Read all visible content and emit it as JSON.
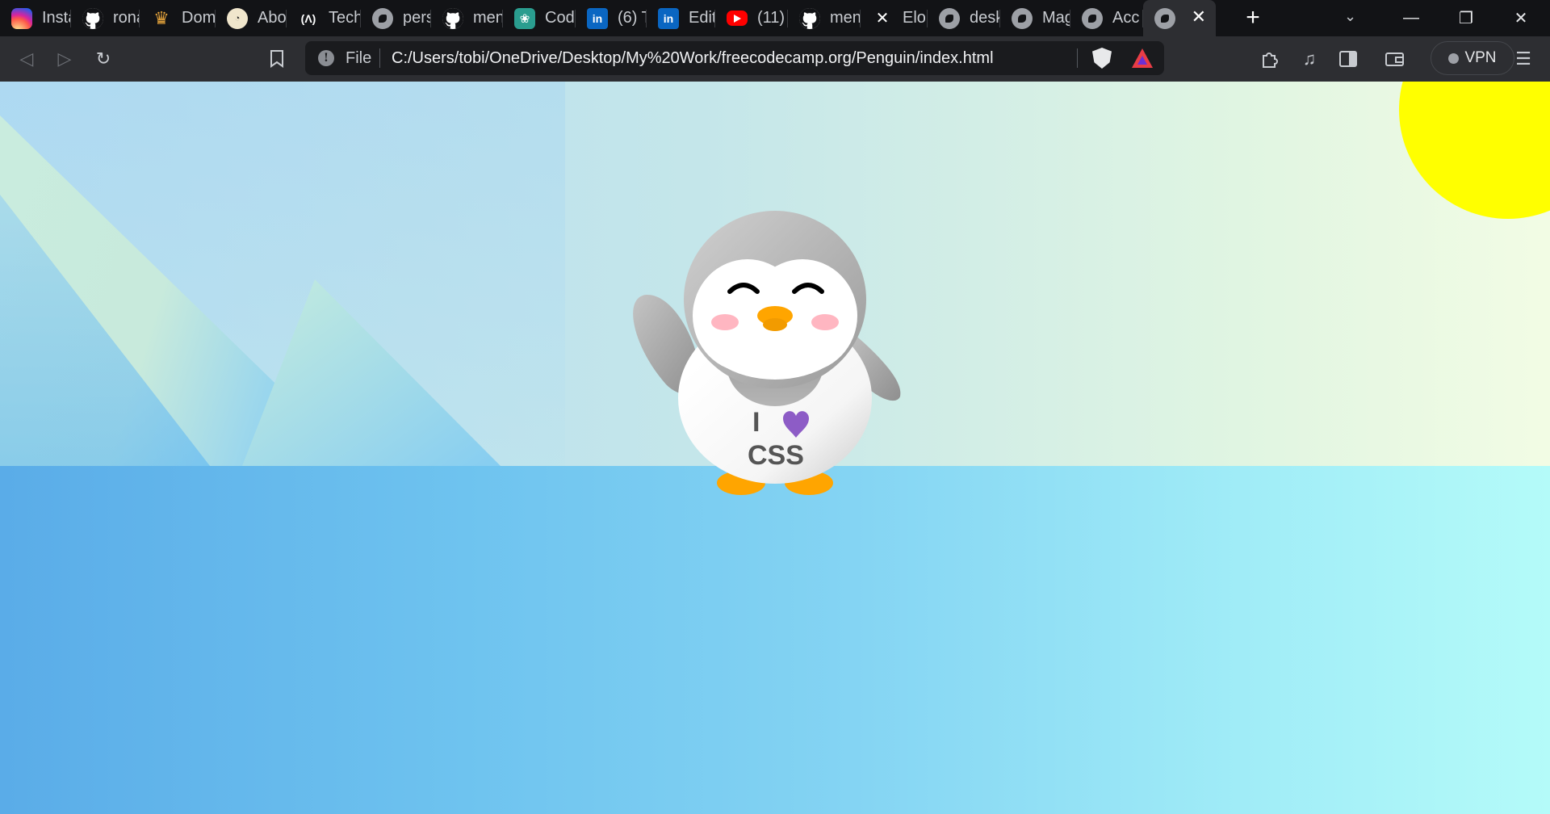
{
  "tabs": [
    {
      "label": "Insta",
      "icon": "instagram-icon"
    },
    {
      "label": "rona",
      "icon": "github-icon"
    },
    {
      "label": "Dom",
      "icon": "crown-icon"
    },
    {
      "label": "Abo",
      "icon": "about-icon"
    },
    {
      "label": "Tech",
      "icon": "tech-icon"
    },
    {
      "label": "pers",
      "icon": "globe-icon"
    },
    {
      "label": "men",
      "icon": "github-icon"
    },
    {
      "label": "Cod",
      "icon": "openai-icon"
    },
    {
      "label": "(6) T",
      "icon": "linkedin-icon"
    },
    {
      "label": "Edit",
      "icon": "linkedin-icon"
    },
    {
      "label": "(11)",
      "icon": "youtube-icon"
    },
    {
      "label": "men",
      "icon": "github-icon"
    },
    {
      "label": "Elon",
      "icon": "x-icon"
    },
    {
      "label": "desk",
      "icon": "globe-icon"
    },
    {
      "label": "Mag",
      "icon": "globe-icon"
    },
    {
      "label": "Acc",
      "icon": "globe-icon"
    },
    {
      "label": "",
      "icon": "globe-icon",
      "active": true
    }
  ],
  "toolbar": {
    "scheme": "File",
    "url": "C:/Users/tobi/OneDrive/Desktop/My%20Work/freecodecamp.org/Penguin/index.html",
    "vpn_label": "VPN"
  },
  "penguin": {
    "shirt_line1": "I",
    "shirt_line2": "CSS",
    "heart_color": "#8d5cc6"
  },
  "colors": {
    "sun": "#ffff00",
    "beak": "#ffa500",
    "cheeks": "#ffb6c1",
    "body_gray": "#a9a9a9"
  }
}
